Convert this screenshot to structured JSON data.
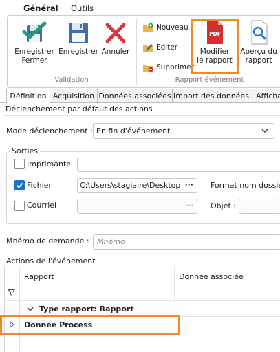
{
  "ribbon": {
    "tabs": [
      "Général",
      "Outils"
    ],
    "validation": {
      "group_label": "Validation",
      "buttons": [
        "Enregistrer\nFermer",
        "Enregistrer",
        "Annuler"
      ]
    },
    "rapport": {
      "group_label": "Rapport événement",
      "small_buttons": [
        "Nouveau",
        "Editer",
        "Supprimer"
      ],
      "modify_label_1": "Modifier",
      "modify_label_2": "le rapport",
      "pdf_text": "PDF",
      "preview_label_1": "Aperçu du",
      "preview_label_2": "rapport"
    }
  },
  "tabs": [
    "Définition",
    "Acquisition",
    "Données associées",
    "Import des données",
    "Afficha"
  ],
  "declenchement": {
    "title": "Déclenchement par défaut des actions",
    "mode_label": "Mode déclenchement :",
    "mode_value": "En fin d'événement"
  },
  "sorties": {
    "title": "Sorties",
    "imprimante_label": "Imprimante",
    "fichier_label": "Fichier",
    "fichier_path": "C:\\Users\\stagiaire\\Desktop",
    "courriel_label": "Courriel",
    "format_label": "Format nom dossier :",
    "objet_label": "Objet :",
    "ellipsis": "···"
  },
  "mnemo": {
    "label": "Mnémo de demande :",
    "placeholder": "Mnémo"
  },
  "actions": {
    "title": "Actions de l'événement",
    "columns": [
      "Rapport",
      "Donnée associée"
    ],
    "group_row": "Type rapport: Rapport",
    "row": "Donnée Process"
  },
  "colors": {
    "accent": "#1a73c9",
    "highlight": "#f0892a",
    "check_green": "#1e9e7a",
    "save_blue": "#3f6fa8",
    "cancel_red": "#d9333f",
    "pdf_red": "#d32f2f"
  }
}
